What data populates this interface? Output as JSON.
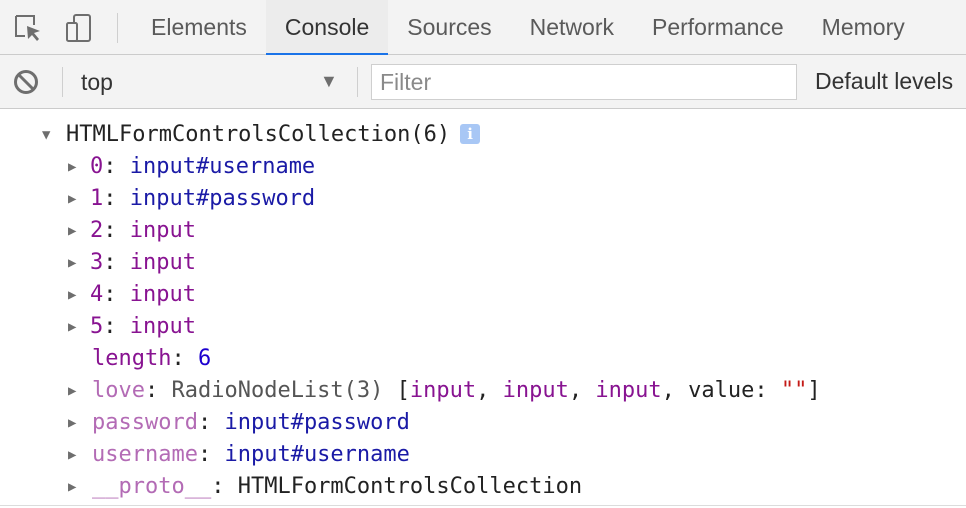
{
  "toolbar": {
    "inspect_icon": "inspect-element-icon",
    "device_icon": "device-toolbar-icon"
  },
  "tabs": [
    {
      "label": "Elements"
    },
    {
      "label": "Console",
      "active": true
    },
    {
      "label": "Sources"
    },
    {
      "label": "Network"
    },
    {
      "label": "Performance"
    },
    {
      "label": "Memory"
    }
  ],
  "console_toolbar": {
    "clear_icon": "clear-console-icon",
    "context": "top",
    "context_arrow": "▼",
    "filter_placeholder": "Filter",
    "filter_value": "",
    "levels": "Default levels"
  },
  "output": {
    "header": {
      "label": "HTMLFormControlsCollection(6)",
      "info": "i"
    },
    "rows": [
      {
        "key": "0",
        "sep": ": ",
        "value": "input#username"
      },
      {
        "key": "1",
        "sep": ": ",
        "value": "input#password"
      },
      {
        "key": "2",
        "sep": ": ",
        "value": "input"
      },
      {
        "key": "3",
        "sep": ": ",
        "value": "input"
      },
      {
        "key": "4",
        "sep": ": ",
        "value": "input"
      },
      {
        "key": "5",
        "sep": ": ",
        "value": "input"
      }
    ],
    "length": {
      "key": "length",
      "sep": ": ",
      "value": "6"
    },
    "love": {
      "key": "love",
      "sep": ": ",
      "type": "RadioNodeList(3)",
      "open": " [",
      "items": [
        "input",
        "input",
        "input"
      ],
      "comma": ", ",
      "value_key": "value",
      "value_sep": ": ",
      "value_str": "\"\"",
      "close": "]"
    },
    "password": {
      "key": "password",
      "sep": ": ",
      "value": "input#password"
    },
    "username": {
      "key": "username",
      "sep": ": ",
      "value": "input#username"
    },
    "proto": {
      "key": "__proto__",
      "sep": ": ",
      "value": "HTMLFormControlsCollection"
    }
  }
}
